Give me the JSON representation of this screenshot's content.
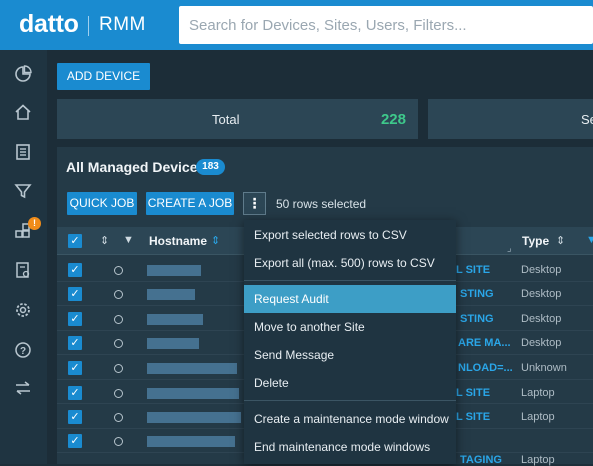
{
  "app": {
    "brand": "datto",
    "product": "RMM"
  },
  "search": {
    "placeholder": "Search for Devices, Sites, Users, Filters..."
  },
  "sidebar": {
    "items": [
      {
        "name": "dashboard",
        "icon": "pie-chart-icon"
      },
      {
        "name": "home",
        "icon": "home-icon"
      },
      {
        "name": "devices",
        "icon": "device-list-icon"
      },
      {
        "name": "filters",
        "icon": "funnel-icon"
      },
      {
        "name": "components",
        "icon": "components-icon",
        "badge": "!"
      },
      {
        "name": "reports",
        "icon": "report-icon"
      },
      {
        "name": "settings",
        "icon": "gear-icon"
      },
      {
        "name": "help",
        "icon": "help-icon"
      },
      {
        "name": "switch",
        "icon": "transfer-icon"
      }
    ]
  },
  "toolbar": {
    "add_device": "ADD DEVICE"
  },
  "stats": {
    "total_label": "Total",
    "total_value": "228",
    "second_label": "Se"
  },
  "devices": {
    "title": "All Managed Devices",
    "count": "183",
    "quick_job": "QUICK JOB",
    "create_job": "CREATE A JOB",
    "more": "⋮",
    "rows_selected": "50 rows selected",
    "columns": {
      "hostname": "Hostname",
      "type": "Type"
    },
    "rows": [
      {
        "site": "L SITE",
        "type": "Desktop"
      },
      {
        "site": "STING",
        "type": "Desktop"
      },
      {
        "site": "STING",
        "type": "Desktop"
      },
      {
        "site": "ARE MA...",
        "type": "Desktop"
      },
      {
        "site": "NLOAD=...",
        "type": "Unknown"
      },
      {
        "site": "L SITE",
        "type": "Laptop"
      },
      {
        "site": "L SITE",
        "type": "Laptop"
      },
      {
        "site": "TAGING",
        "type": "Laptop"
      }
    ]
  },
  "menu": {
    "export_selected": "Export selected rows to CSV",
    "export_all": "Export all (max. 500) rows to CSV",
    "request_audit": "Request Audit",
    "move_site": "Move to another Site",
    "send_message": "Send Message",
    "delete": "Delete",
    "create_maintenance": "Create a maintenance mode window",
    "end_maintenance": "End maintenance mode windows"
  },
  "colors": {
    "accent": "#1a8bd0",
    "highlight": "#3d9ec6",
    "success": "#3ec88b",
    "warning": "#f08c1a"
  }
}
